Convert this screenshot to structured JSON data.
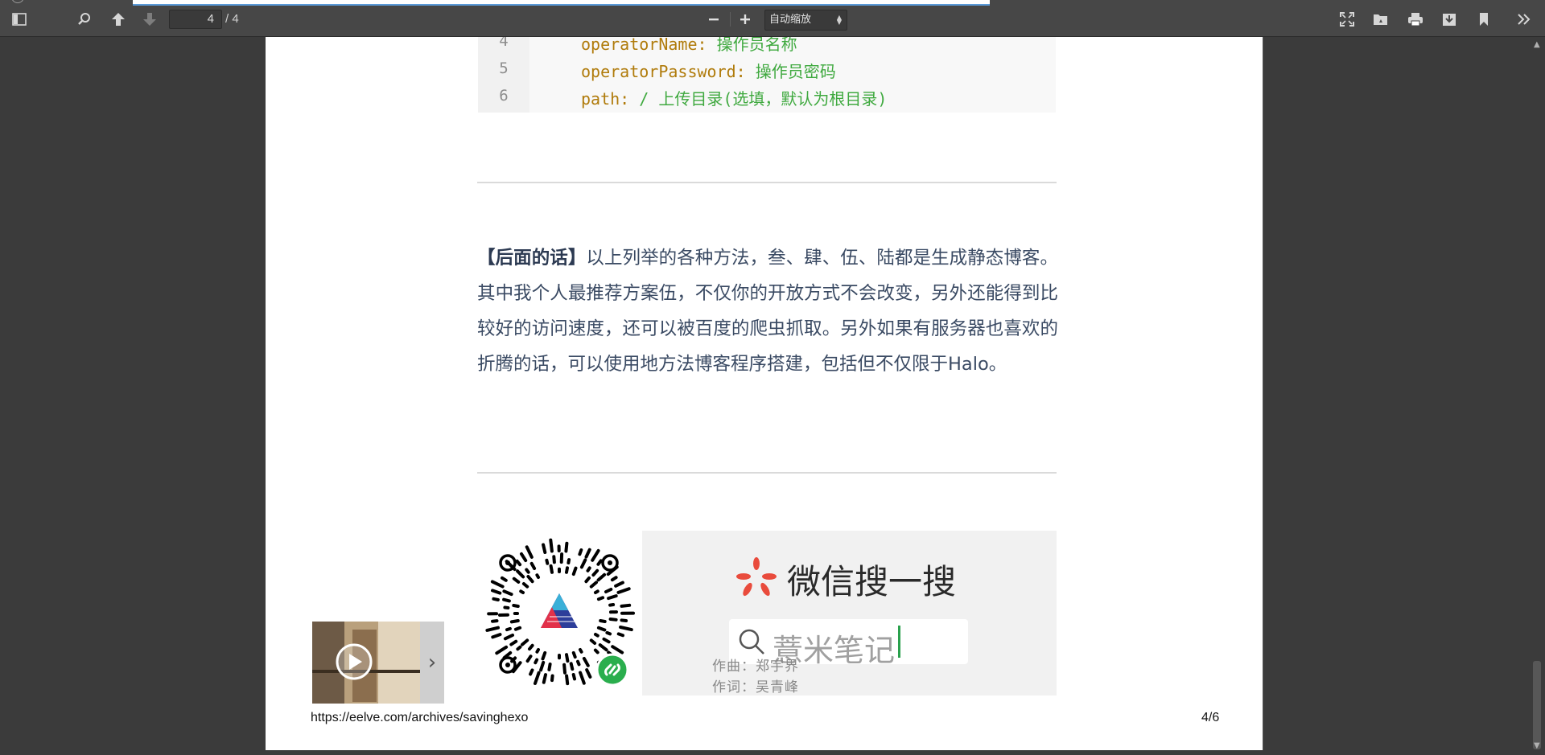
{
  "toolbar": {
    "current_page": "4",
    "page_total": "/ 4",
    "zoom_label": "自动缩放"
  },
  "code": {
    "lines": [
      {
        "num": "4",
        "key": "operatorName:",
        "value": "操作员名称"
      },
      {
        "num": "5",
        "key": "operatorPassword:",
        "value": "操作员密码"
      },
      {
        "num": "6",
        "key": "path:",
        "value": "/ 上传目录(选填，默认为根目录)"
      }
    ]
  },
  "article": {
    "bold_lead": "【后面的话】",
    "body": "以上列举的各种方法，叁、肆、伍、陆都是生成静态博客。其中我个人最推荐方案伍，不仅你的开放方式不会改变，另外还能得到比较好的访问速度，还可以被百度的爬虫抓取。另外如果有服务器也喜欢的折腾的话，可以使用地方法博客程序搭建，包括但不仅限于Halo。"
  },
  "wechat": {
    "search_title": "微信搜一搜",
    "search_query": "薏米笔记"
  },
  "music": {
    "composer": "作曲：郑宇界",
    "lyricist": "作词：吴青峰"
  },
  "footer": {
    "url": "https://eelve.com/archives/savinghexo",
    "page_number": "4/6"
  },
  "colors": {
    "toolbar": "#474747",
    "viewer_bg": "#3b3b3b",
    "code_key": "#b07b0b",
    "code_value": "#3fa93f",
    "body_text": "#3a4a63"
  }
}
